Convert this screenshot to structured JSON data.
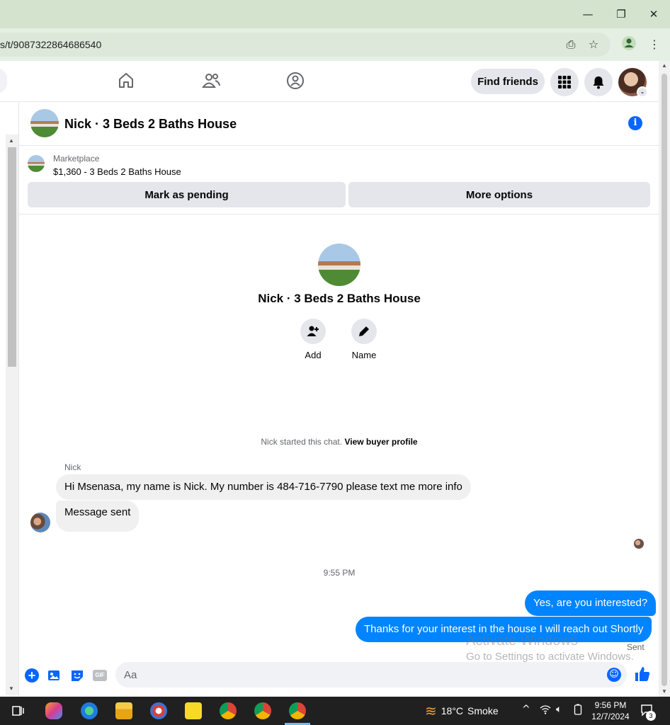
{
  "browser": {
    "url": "s/t/9087322864686540",
    "window_controls": {
      "minimize": "—",
      "restore": "❐",
      "close": "✕"
    }
  },
  "fb_nav": {
    "find_friends_label": "Find friends",
    "icons": [
      "home-icon",
      "friends-icon",
      "groups-icon",
      "menu-grid-icon",
      "notifications-icon"
    ]
  },
  "chat": {
    "title": "Nick · 3 Beds 2 Baths House",
    "marketplace": {
      "label": "Marketplace",
      "listing": "$1,360 - 3 Beds 2 Baths House",
      "mark_pending_label": "Mark as pending",
      "more_options_label": "More options"
    },
    "profile": {
      "name": "Nick · 3 Beds 2 Baths House",
      "actions": [
        {
          "label": "Add"
        },
        {
          "label": "Name"
        }
      ]
    },
    "system": {
      "started": "Nick started this chat.",
      "buyer_link": "View buyer profile"
    },
    "messages": {
      "sender": "Nick",
      "incoming": [
        "Hi Msenasa, my name is Nick. My number is 484-716-7790 please text me more info",
        "Message sent"
      ],
      "time": "9:55 PM",
      "outgoing": [
        "Yes, are you interested?",
        "Thanks for your interest in the house I will reach out Shortly"
      ],
      "status": "Sent"
    },
    "composer": {
      "placeholder": "Aa",
      "gif_label": "GIF"
    }
  },
  "watermark": {
    "line1": "Activate Windows",
    "line2": "Go to Settings to activate Windows."
  },
  "taskbar": {
    "weather_temp": "18°C",
    "weather_text": "Smoke",
    "time": "9:56 PM",
    "date": "12/7/2024",
    "notification_count": "3"
  },
  "colors": {
    "messenger_blue": "#0084ff",
    "fb_blue": "#0866ff",
    "titlebar": "#d3e3cd"
  }
}
